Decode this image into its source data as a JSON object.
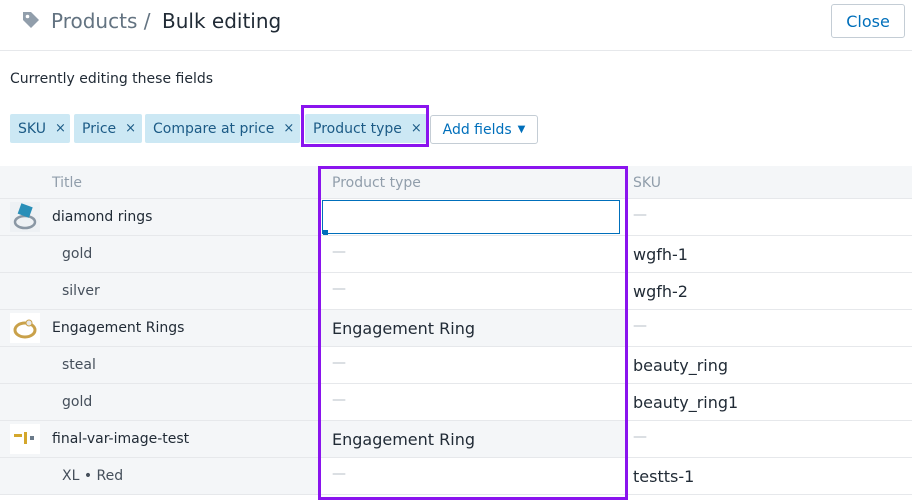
{
  "header": {
    "breadcrumb": "Products",
    "separator": "/",
    "title": "Bulk editing",
    "close_label": "Close"
  },
  "editing_label": "Currently editing these fields",
  "chips": [
    {
      "label": "SKU",
      "remove": "×"
    },
    {
      "label": "Price",
      "remove": "×"
    },
    {
      "label": "Compare at price",
      "remove": "×"
    },
    {
      "label": "Product type",
      "remove": "×"
    }
  ],
  "add_fields": {
    "label": "Add fields",
    "caret": "▼"
  },
  "columns": {
    "title": "Title",
    "product_type": "Product type",
    "sku": "SKU"
  },
  "rows": [
    {
      "title": "diamond rings",
      "product_type": "",
      "sku": "—"
    },
    {
      "title": "gold",
      "product_type": "—",
      "sku": "wgfh-1"
    },
    {
      "title": "silver",
      "product_type": "—",
      "sku": "wgfh-2"
    },
    {
      "title": "Engagement Rings",
      "product_type": "Engagement Ring",
      "sku": "—"
    },
    {
      "title": "steal",
      "product_type": "—",
      "sku": "beauty_ring"
    },
    {
      "title": "gold",
      "product_type": "—",
      "sku": "beauty_ring1"
    },
    {
      "title": "final-var-image-test",
      "product_type": "Engagement Ring",
      "sku": "—"
    },
    {
      "title": "XL • Red",
      "product_type": "—",
      "sku": "testts-1"
    }
  ],
  "colors": {
    "accent": "#006fbb",
    "highlight": "#8a14ee",
    "chip_bg": "#cce8f4"
  },
  "icons": {
    "breadcrumb": "tag-icon"
  }
}
